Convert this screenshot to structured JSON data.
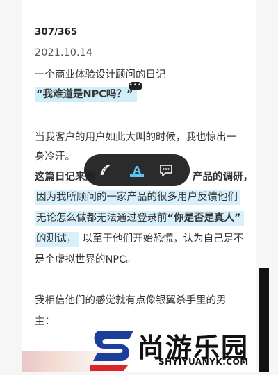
{
  "article": {
    "counter": "307/365",
    "date": "2021.10.14",
    "subtitle": "一个商业体验设计顾问的日记",
    "headline": "“我难道是NPC吗？”",
    "para1_line1": "当我客户的用户如此大叫的时候，我也惊出一",
    "para1_line2": "身冷汗。",
    "para2_line1_a": "这篇日记来源",
    "para2_line1_b": "产品的调研，",
    "para2_line2": "因为我所顾问的一家产品的很多用户反馈他们",
    "para2_line3_a": "无论怎么做都无法通过登录前",
    "para2_line3_b": "“你是否是真人”",
    "para2_line4_a": "的测试，",
    "para2_line4_b": "以至于他们开始恐慌，认为自己是不",
    "para2_line5": "是个虚拟世界的NPC。",
    "para3_line1": "我相信他们的感觉就有点像银翼杀手里的男",
    "para3_line2": "主："
  },
  "comment_badge": "•••",
  "toolbar": {
    "icons": [
      "feather-pen-icon",
      "highlight-a-icon",
      "comment-bubble-icon"
    ],
    "highlight_letter": "A"
  },
  "watermark": {
    "brand": "尚游乐园",
    "url": "SHYIYUANYK.COM",
    "colors": {
      "s_blue": "#1b3f9a",
      "s_red": "#d8252c"
    }
  }
}
